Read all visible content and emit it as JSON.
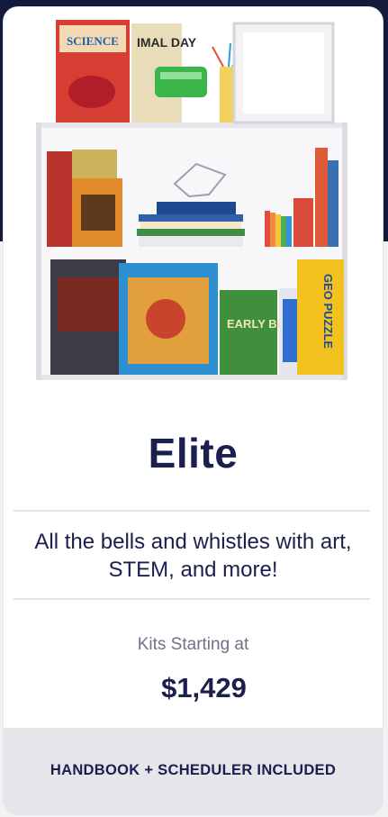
{
  "plan": {
    "title": "Elite",
    "description": "All the bells and whistles with art, STEM, and more!",
    "price_caption": "Kits Starting at",
    "price": "$1,429",
    "footer_note": "HANDBOOK + SCHEDULER INCLUDED"
  },
  "image": {
    "book_titles": [
      "SCIENCE",
      "IMAL DAY",
      "EARLY BIRD",
      "GEO PUZZLE"
    ]
  },
  "colors": {
    "navy": "#1b1f4e",
    "background_dark": "#141a3c",
    "footer_bg": "#e5e5ea",
    "divider": "#e3e3e7"
  }
}
